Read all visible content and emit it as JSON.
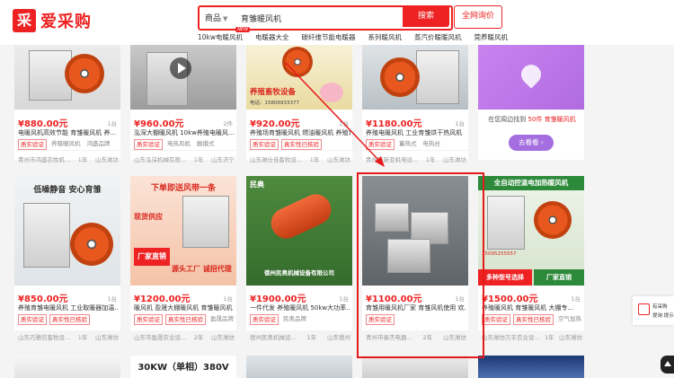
{
  "header": {
    "logo_mark": "采",
    "logo_text": "爱采购",
    "search_category": "商品",
    "search_value": "育雏暖风机",
    "search_button": "搜索",
    "inquiry_button": "全网询价",
    "hot_links": [
      "10kw电暖风机",
      "电暖器大全",
      "碳纤维节能电暖器",
      "系列暖风机",
      "蒸汽价暖暖风机",
      "莞养暖风机"
    ],
    "new_badge": "NEW"
  },
  "colors": {
    "brand": "#e22222",
    "highlight": "#e51b1b",
    "promo_purple": "#a46ee0"
  },
  "cards": [
    {
      "price": "¥880.00元",
      "sold": "1台",
      "title": "电暖风机高效节能 育雏暖风机 养...",
      "badges": [
        "质实验证",
        "养殖暖风机",
        "鸿盛品牌"
      ],
      "seller": "青州市鸿盛农牧机...",
      "years": "1年",
      "region": "山东潍坊"
    },
    {
      "price": "¥960.00元",
      "sold": "2件",
      "title": "泓深大棚暖风机 10kw养殖电暖风...",
      "badges": [
        "质实验证",
        "电热风机",
        "触摸式"
      ],
      "seller": "山东泓深机械有限...",
      "years": "1年",
      "region": "山东济宁"
    },
    {
      "price": "¥920.00元",
      "sold": "1台",
      "title": "养殖场育雏暖风机 燃油暖风机 养殖育雏...",
      "badges": [
        "质实验证",
        "真实性已核验"
      ],
      "seller": "山东潍仕佳畜牧设...",
      "years": "1年",
      "region": "山东潍坊",
      "img_caption": "养殖畜牧设备",
      "img_phone": "电话：15806933377"
    },
    {
      "price": "¥1180.00元",
      "sold": "1台",
      "title": "养殖电暖风机 工业育雏烘干热风机",
      "badges": [
        "质实验证",
        "蓄热式",
        "电热丝"
      ],
      "seller": "青州市新亚机电设...",
      "years": "1年",
      "region": "山东潍坊"
    },
    {
      "price": "¥850.00元",
      "sold": "1台",
      "title": "养殖育雏电暖风机 工业取暖器加温...",
      "badges": [
        "质实验证",
        "真实性已核验"
      ],
      "seller": "山东巧骆信畜牧设...",
      "years": "1年",
      "region": "山东潍坊",
      "img_banner": "低噪静音 安心育雏"
    },
    {
      "price": "¥1200.00元",
      "sold": "1台",
      "title": "暖风机 盈晟大棚暖风机 育雏暖风机 制作...",
      "badges": [
        "质实验证",
        "真实性已核验",
        "盈晟品牌"
      ],
      "seller": "山东市盈晟农业设...",
      "years": "2年",
      "region": "山东潍坊",
      "img_banner": "下单即送风带一条",
      "img_caption": "源头工厂 诚招代理",
      "img_side": "现货供应",
      "img_tag": "厂家直销"
    },
    {
      "price": "¥1900.00元",
      "sold": "1台",
      "title": "一件代发 养殖暖风机 50kw大功率...",
      "badges": [
        "质实验证",
        "民奥品牌"
      ],
      "seller": "德州民奥机械设...",
      "years": "1年",
      "region": "山东德州",
      "img_caption": "德州民奥机械设备有限公司",
      "img_logo": "民奥"
    },
    {
      "price": "¥1100.00元",
      "sold": "1台",
      "title": "育雏用暖风机厂家 育雏风机使用 欢...",
      "badges": [
        "质实验证"
      ],
      "seller": "青州市春杰电器...",
      "years": "2年",
      "region": "山东潍坊"
    },
    {
      "price": "¥1500.00元",
      "sold": "1台",
      "title": "养殖暖风机 育雏暖风机 大棚专...",
      "badges": [
        "质实验证",
        "真实性已核验",
        "空气加热"
      ],
      "seller": "山东潍坊万丰农业设...",
      "years": "1年",
      "region": "山东潍坊",
      "img_banner": "全自动控温电加热暖风机",
      "img_side": "多种型号选择",
      "img_tag": "厂家直销",
      "img_phone": "15095255557"
    }
  ],
  "row3": [
    {
      "text": ""
    },
    {
      "text": "30KW（单相）380V"
    },
    {
      "text": ""
    },
    {
      "text": ""
    },
    {
      "text": ""
    }
  ],
  "promo": {
    "text_prefix": "在您周边找到 ",
    "count": "50件",
    "text_suffix": " 育雏暖风机",
    "button": "去看看 ›"
  },
  "side": {
    "chat_line1": "有采购",
    "chat_line2": "提询 提示"
  }
}
